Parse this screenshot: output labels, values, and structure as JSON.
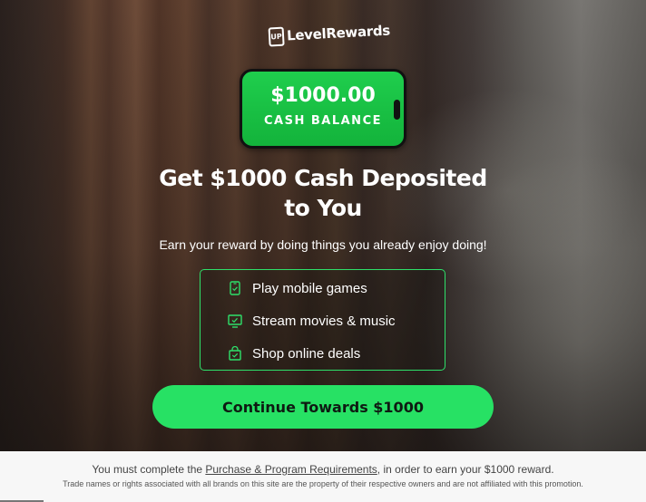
{
  "brand": {
    "badge": "UP",
    "name": "LevelRewards"
  },
  "phone": {
    "amount": "$1000.00",
    "label": "CASH BALANCE"
  },
  "headline": {
    "line1": "Get $1000 Cash Deposited",
    "line2": "to You"
  },
  "subhead": "Earn your reward by doing things you already enjoy doing!",
  "features": [
    {
      "icon": "phone-icon",
      "label": "Play mobile games"
    },
    {
      "icon": "monitor-icon",
      "label": "Stream movies & music"
    },
    {
      "icon": "shopping-bag-icon",
      "label": "Shop online deals"
    }
  ],
  "cta": {
    "label": "Continue Towards $1000"
  },
  "footer": {
    "line1_prefix": "You must complete the ",
    "requirements_link": "Purchase & Program Requirements",
    "line1_suffix": ", in order to earn your $1000 reward.",
    "disclaimer": "Trade names or rights associated with all brands on this site are the property of their respective owners and are not affiliated with this promotion."
  },
  "colors": {
    "accent_green": "#27e164",
    "border_green": "#2ee06a",
    "phone_green": "#1fce4d"
  }
}
